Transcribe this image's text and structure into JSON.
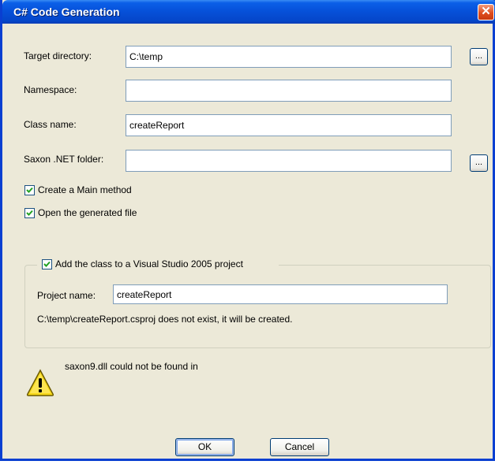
{
  "window": {
    "title": "C# Code Generation",
    "close_glyph": "✕"
  },
  "fields": {
    "target_directory": {
      "label": "Target directory:",
      "value": "C:\\temp"
    },
    "namespace": {
      "label": "Namespace:",
      "value": ""
    },
    "class_name": {
      "label": "Class name:",
      "value": "createReport"
    },
    "saxon_folder": {
      "label": "Saxon .NET folder:",
      "value": ""
    }
  },
  "browse_label": "...",
  "checkboxes": {
    "main_method": {
      "label": "Create a Main method",
      "checked": true
    },
    "open_file": {
      "label": "Open the generated file",
      "checked": true
    }
  },
  "project_group": {
    "checkbox_label": "Add the class to a Visual Studio 2005 project",
    "checked": true,
    "project_name_label": "Project name:",
    "project_name_value": "createReport",
    "status_text": "C:\\temp\\createReport.csproj does not exist, it will be created."
  },
  "warning": {
    "icon": "warning-icon",
    "text": "saxon9.dll could not be found in"
  },
  "buttons": {
    "ok": "OK",
    "cancel": "Cancel"
  }
}
